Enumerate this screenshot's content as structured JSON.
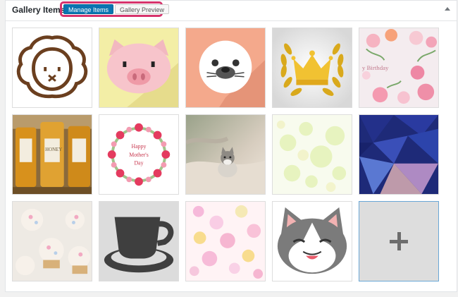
{
  "panel": {
    "title": "Gallery Items",
    "tabs": [
      {
        "label": "Manage Items",
        "active": true
      },
      {
        "label": "Gallery Preview",
        "active": false
      }
    ],
    "collapse_icon": "triangle-up-icon"
  },
  "gallery": {
    "items": [
      {
        "name": "sheep-face-image"
      },
      {
        "name": "pig-image"
      },
      {
        "name": "seal-image"
      },
      {
        "name": "crown-laurel-image"
      },
      {
        "name": "birthday-flowers-image"
      },
      {
        "name": "honey-jars-image"
      },
      {
        "name": "mothers-day-wreath-image"
      },
      {
        "name": "kitten-on-blanket-image"
      },
      {
        "name": "green-bokeh-image"
      },
      {
        "name": "blue-polygon-image"
      },
      {
        "name": "cupcakes-image"
      },
      {
        "name": "coffee-cup-image"
      },
      {
        "name": "pink-bokeh-image"
      },
      {
        "name": "gray-cat-image"
      }
    ],
    "add_tile_icon": "plus-icon",
    "image_texts": {
      "birthday": "y Birthday",
      "honey": "HONEY",
      "mothers_line1": "Happy",
      "mothers_line2": "Mother's",
      "mothers_line3": "Day"
    }
  }
}
